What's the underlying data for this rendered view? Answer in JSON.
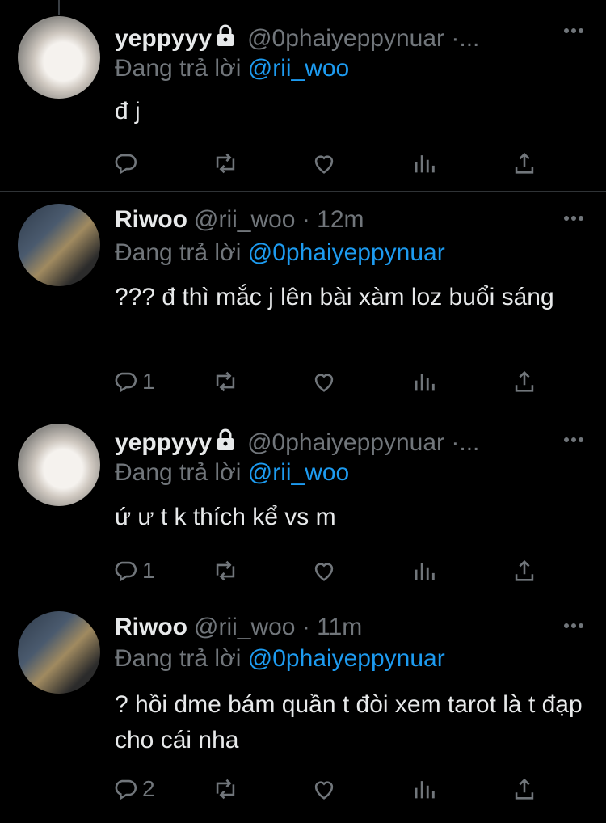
{
  "tweets": [
    {
      "name": "yeppyyy",
      "handle": "@0phaiyeppynuar ·...",
      "locked": true,
      "reply_label": "Đang trả lời",
      "reply_to": "@rii_woo",
      "text": "đ j",
      "reply_count": "",
      "avatar": "cat-avatar"
    },
    {
      "name": "Riwoo",
      "handle": "@rii_woo · 12m",
      "locked": false,
      "reply_label": "Đang trả lời",
      "reply_to": "@0phaiyeppynuar",
      "text": "??? đ thì mắc j lên bài xàm loz buổi sáng",
      "reply_count": "1",
      "avatar": "user-avatar"
    },
    {
      "name": "yeppyyy",
      "handle": "@0phaiyeppynuar ·...",
      "locked": true,
      "reply_label": "Đang trả lời",
      "reply_to": "@rii_woo",
      "text": "ứ ư t k thích kể vs m",
      "reply_count": "1",
      "avatar": "cat-avatar"
    },
    {
      "name": "Riwoo",
      "handle": "@rii_woo · 11m",
      "locked": false,
      "reply_label": "Đang trả lời",
      "reply_to": "@0phaiyeppynuar",
      "text": "? hồi dme bám quần t đòi xem tarot là t đạp cho cái nha",
      "reply_count": "2",
      "avatar": "user-avatar"
    }
  ],
  "colors": {
    "background": "#000000",
    "text": "#e7e9ea",
    "muted": "#71767b",
    "link": "#1d9bf0",
    "divider": "#2f3336"
  },
  "icons": [
    "reply-icon",
    "retweet-icon",
    "like-icon",
    "analytics-icon",
    "share-icon",
    "more-icon",
    "lock-icon"
  ]
}
